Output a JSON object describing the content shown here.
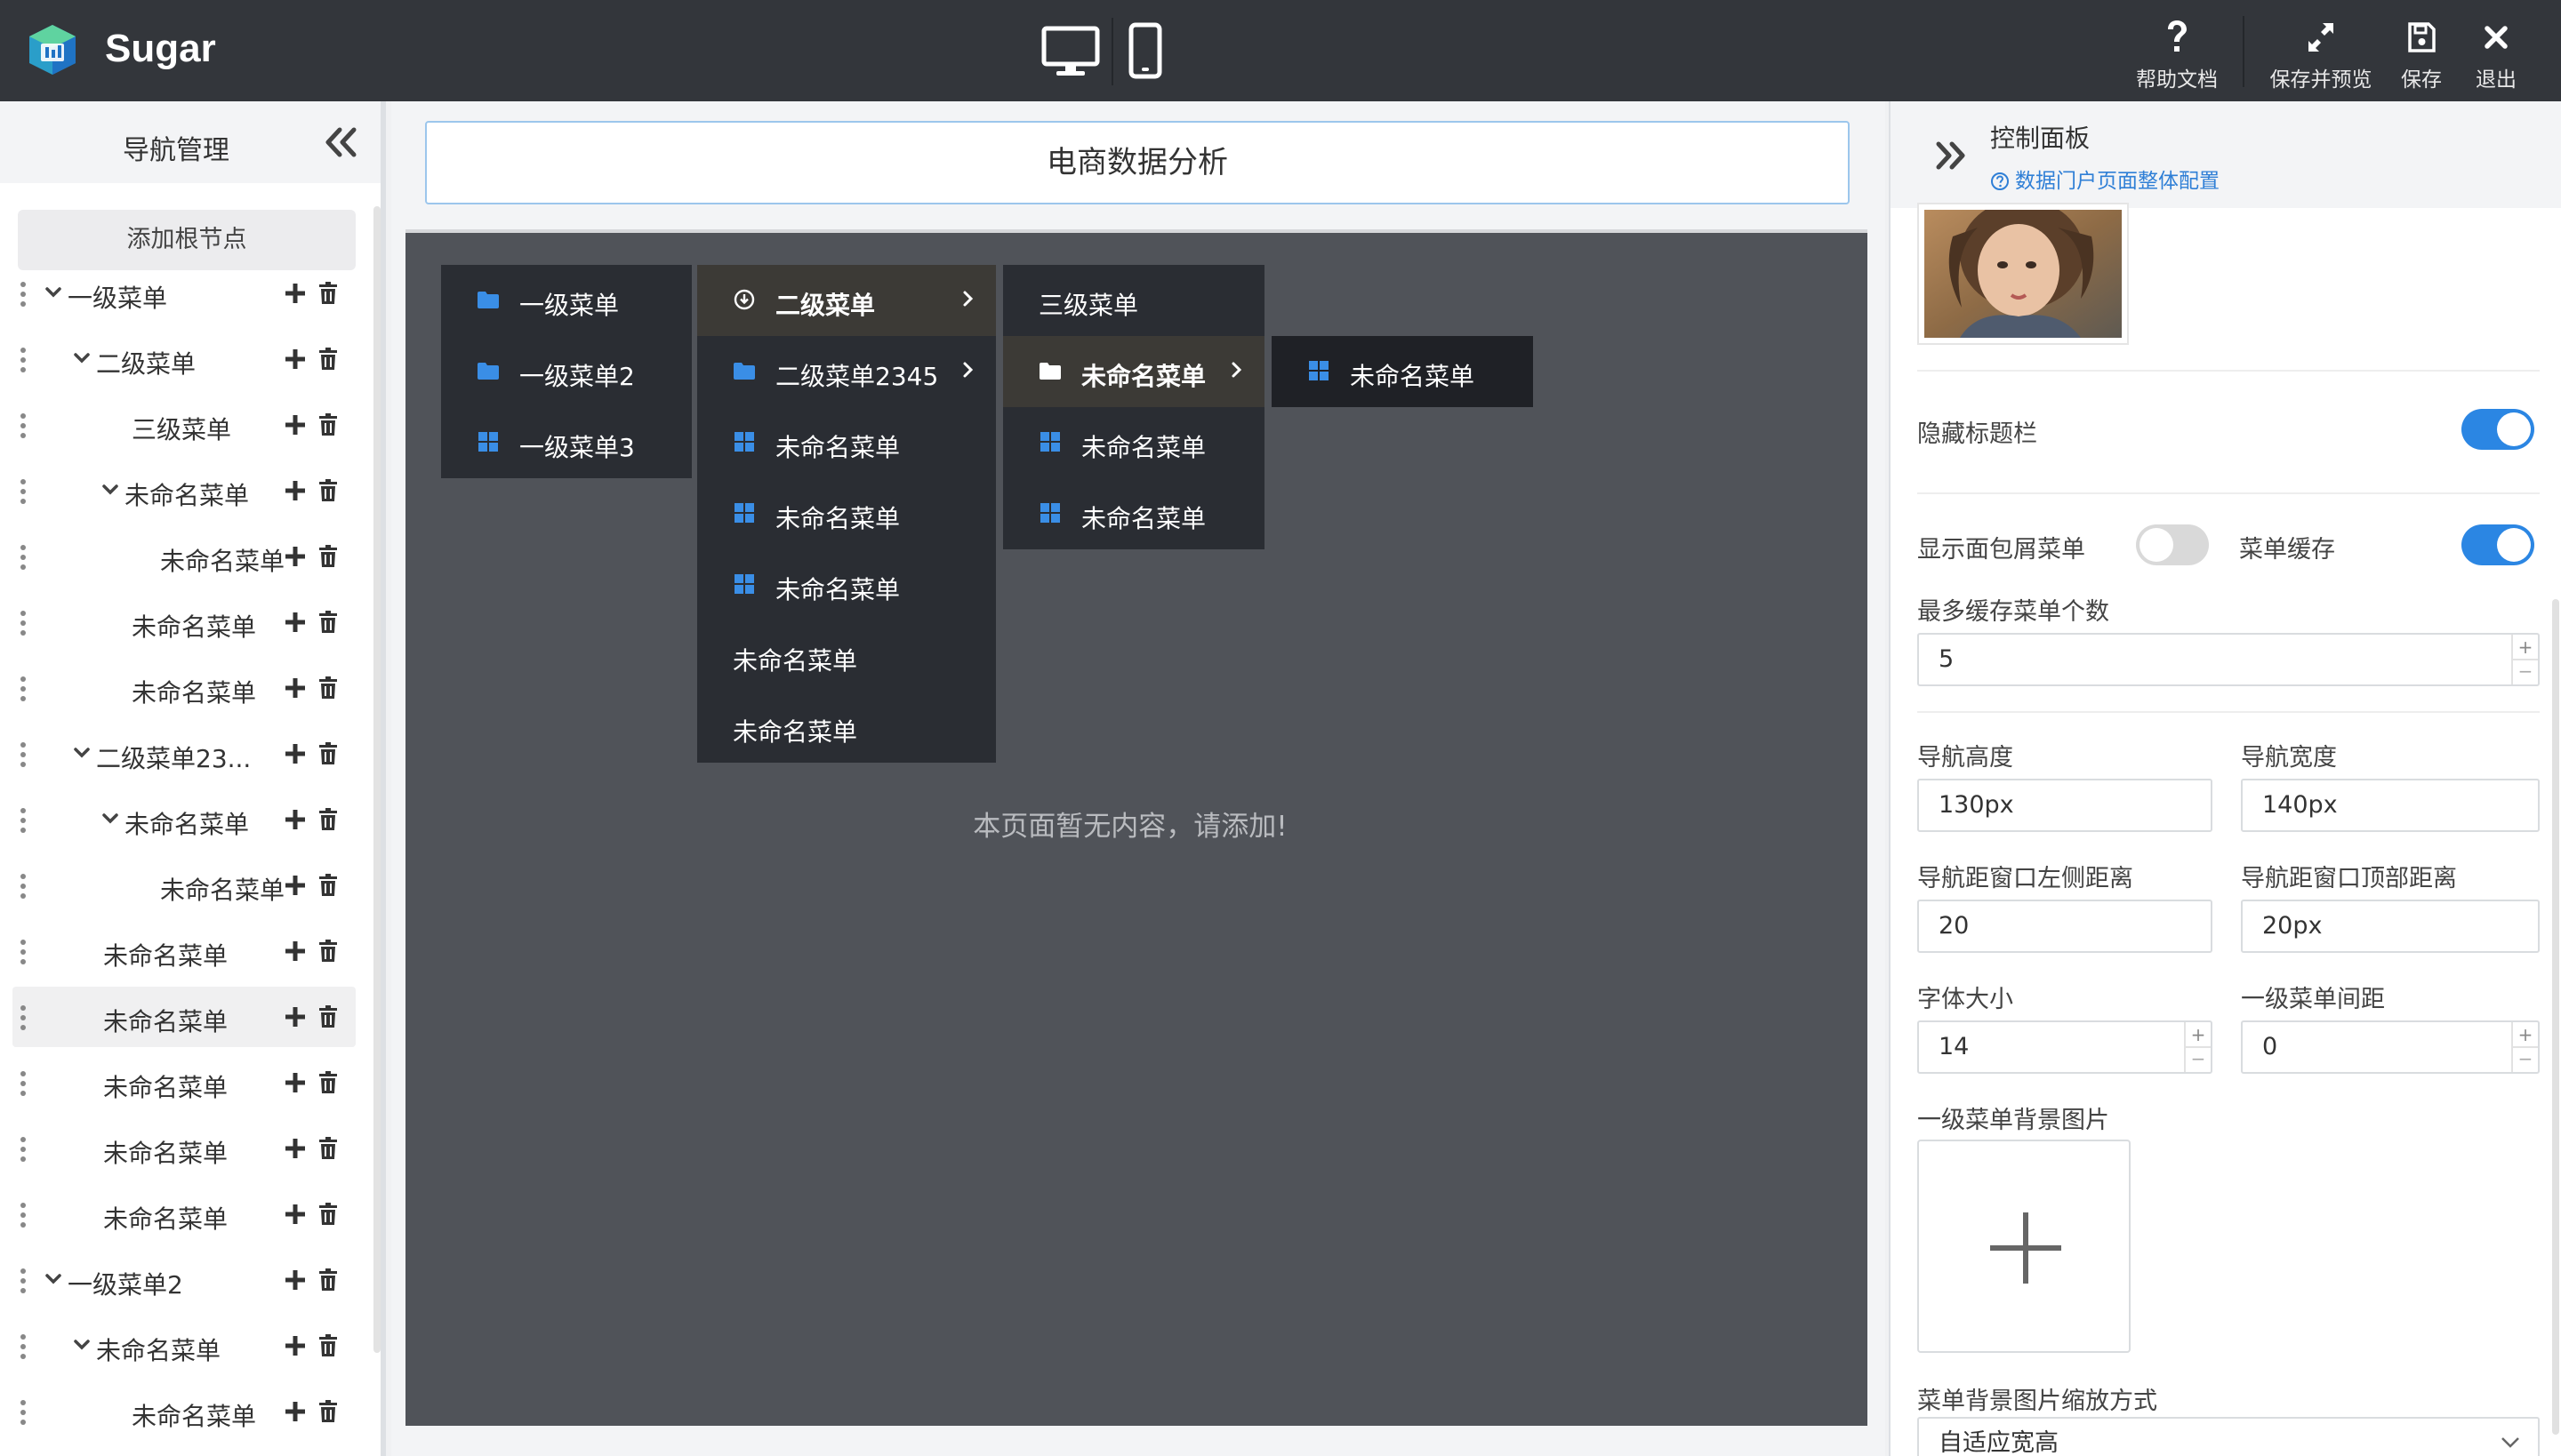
{
  "app": {
    "title": "Sugar"
  },
  "toolbar": {
    "help": "帮助文档",
    "save_preview": "保存并预览",
    "save": "保存",
    "exit": "退出"
  },
  "left_panel": {
    "title": "导航管理",
    "add_root": "添加根节点",
    "tree": [
      {
        "label": "一级菜单",
        "level": 0,
        "expanded": true
      },
      {
        "label": "二级菜单",
        "level": 1,
        "expanded": true
      },
      {
        "label": "三级菜单",
        "level": 2,
        "expanded": false
      },
      {
        "label": "未命名菜单",
        "level": 2,
        "expanded": true
      },
      {
        "label": "未命名菜单",
        "level": 3,
        "expanded": false
      },
      {
        "label": "未命名菜单",
        "level": 2,
        "expanded": false
      },
      {
        "label": "未命名菜单",
        "level": 2,
        "expanded": false
      },
      {
        "label": "二级菜单23...",
        "level": 1,
        "expanded": true
      },
      {
        "label": "未命名菜单",
        "level": 2,
        "expanded": true
      },
      {
        "label": "未命名菜单",
        "level": 3,
        "expanded": false
      },
      {
        "label": "未命名菜单",
        "level": 1,
        "expanded": false
      },
      {
        "label": "未命名菜单",
        "level": 1,
        "expanded": false,
        "selected": true
      },
      {
        "label": "未命名菜单",
        "level": 1,
        "expanded": false
      },
      {
        "label": "未命名菜单",
        "level": 1,
        "expanded": false
      },
      {
        "label": "未命名菜单",
        "level": 1,
        "expanded": false
      },
      {
        "label": "一级菜单2",
        "level": 0,
        "expanded": true
      },
      {
        "label": "未命名菜单",
        "level": 1,
        "expanded": true
      },
      {
        "label": "未命名菜单",
        "level": 2,
        "expanded": false
      }
    ]
  },
  "center": {
    "page_title": "电商数据分析",
    "empty_tip": "本页面暂无内容，请添加!",
    "menu": {
      "level1": [
        {
          "label": "一级菜单",
          "icon": "folder-icon"
        },
        {
          "label": "一级菜单2",
          "icon": "folder-icon"
        },
        {
          "label": "一级菜单3",
          "icon": "grid-icon"
        }
      ],
      "level2": [
        {
          "label": "二级菜单",
          "icon": "circle-download-icon",
          "submenu": true
        },
        {
          "label": "二级菜单2345",
          "icon": "folder-icon",
          "submenu": true
        },
        {
          "label": "未命名菜单",
          "icon": "grid-icon"
        },
        {
          "label": "未命名菜单",
          "icon": "grid-icon"
        },
        {
          "label": "未命名菜单",
          "icon": "grid-icon"
        },
        {
          "label": "未命名菜单",
          "icon": ""
        },
        {
          "label": "未命名菜单",
          "icon": ""
        }
      ],
      "level3": [
        {
          "label": "三级菜单",
          "icon": ""
        },
        {
          "label": "未命名菜单",
          "icon": "folder-icon",
          "submenu": true
        },
        {
          "label": "未命名菜单",
          "icon": "grid-icon"
        },
        {
          "label": "未命名菜单",
          "icon": "grid-icon"
        }
      ],
      "level4": [
        {
          "label": "未命名菜单",
          "icon": "grid-icon"
        }
      ]
    }
  },
  "right_panel": {
    "title": "控制面板",
    "config_link": "数据门户页面整体配置",
    "hide_title_bar": {
      "label": "隐藏标题栏",
      "on": true
    },
    "show_breadcrumb": {
      "label": "显示面包屑菜单",
      "on": false
    },
    "menu_cache": {
      "label": "菜单缓存",
      "on": true
    },
    "max_cache": {
      "label": "最多缓存菜单个数",
      "value": "5"
    },
    "nav_height": {
      "label": "导航高度",
      "value": "130px"
    },
    "nav_width": {
      "label": "导航宽度",
      "value": "140px"
    },
    "nav_left": {
      "label": "导航距窗口左侧距离",
      "value": "20"
    },
    "nav_top": {
      "label": "导航距窗口顶部距离",
      "value": "20px"
    },
    "font_size": {
      "label": "字体大小",
      "value": "14"
    },
    "l1_spacing": {
      "label": "一级菜单间距",
      "value": "0"
    },
    "l1_bg_image": {
      "label": "一级菜单背景图片"
    },
    "bg_scale": {
      "label": "菜单背景图片缩放方式",
      "value": "自适应宽高"
    }
  },
  "colors": {
    "topbar": "#33363b",
    "accent": "#2b86e3",
    "canvas": "#505359",
    "menu_bg": "#2a2d33",
    "icon_blue": "#3a8ee6"
  }
}
